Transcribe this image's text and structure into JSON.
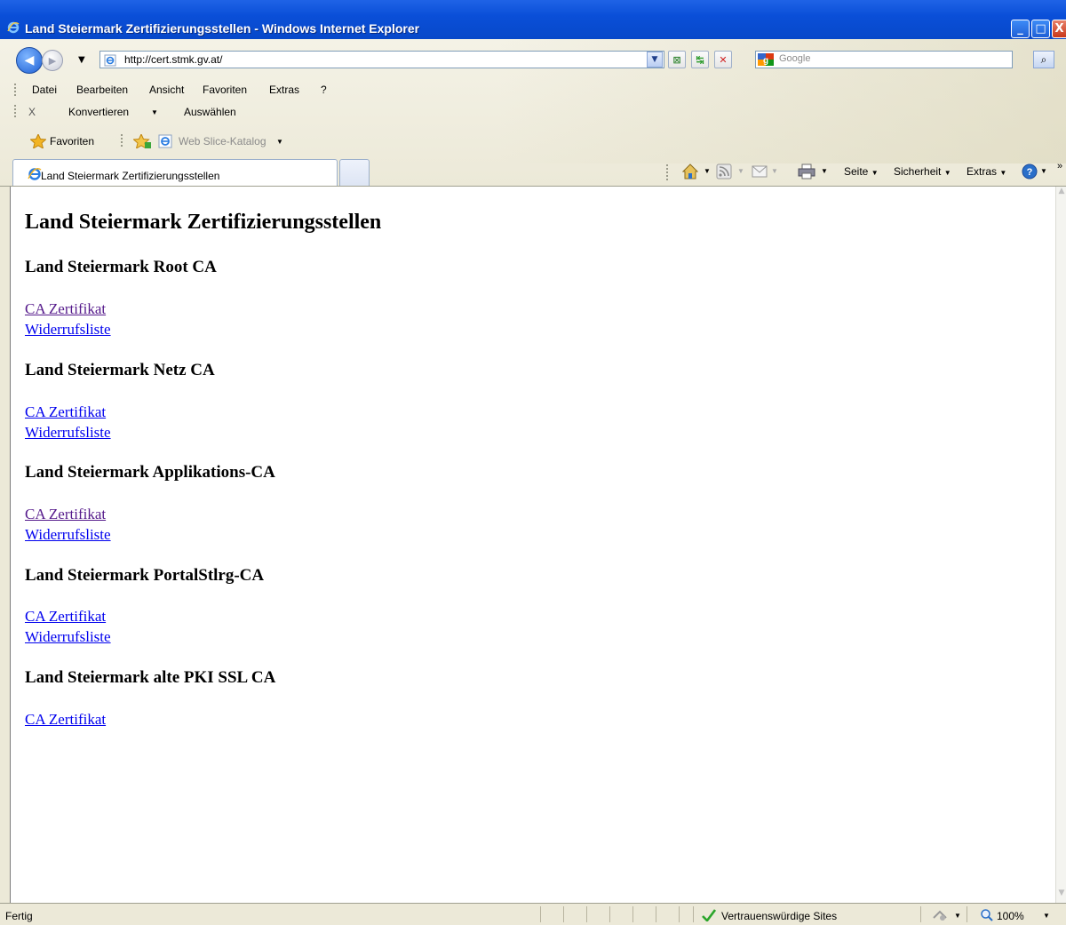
{
  "window": {
    "title": "Land Steiermark Zertifizierungsstellen - Windows Internet Explorer",
    "min_label": "_",
    "max_label": "□",
    "close_label": "X"
  },
  "address": {
    "url": "http://cert.stmk.gv.at/"
  },
  "search": {
    "placeholder": "Google"
  },
  "menu": {
    "items": [
      "Datei",
      "Bearbeiten",
      "Ansicht",
      "Favoriten",
      "Extras",
      "?"
    ]
  },
  "toolbar": {
    "close_glyph": "X",
    "convert_label": "Konvertieren",
    "select_label": "Auswählen"
  },
  "favorites": {
    "favorites_label": "Favoriten",
    "webslice_label": "Web Slice-Katalog"
  },
  "tabs": {
    "active_label": "Land Steiermark Zertifizierungsstellen"
  },
  "commandbar": {
    "page_label": "Seite",
    "safety_label": "Sicherheit",
    "tools_label": "Extras"
  },
  "page": {
    "title": "Land Steiermark Zertifizierungsstellen",
    "sections": [
      {
        "title": "Land Steiermark Root CA",
        "links": [
          "CA Zertifikat",
          "Widerrufsliste"
        ]
      },
      {
        "title": "Land Steiermark Netz CA",
        "links": [
          "CA Zertifikat",
          "Widerrufsliste"
        ]
      },
      {
        "title": "Land Steiermark Applikations-CA",
        "links": [
          "CA Zertifikat",
          "Widerrufsliste"
        ]
      },
      {
        "title": "Land Steiermark PortalStlrg-CA",
        "links": [
          "CA Zertifikat",
          "Widerrufsliste"
        ]
      },
      {
        "title": "Land Steiermark alte PKI SSL CA",
        "links": [
          "CA Zertifikat"
        ]
      }
    ]
  },
  "status": {
    "text": "Fertig",
    "zone": "Vertrauenswürdige Sites",
    "zoom": "100%"
  },
  "colors": {
    "titlebar": "#0a4fd8",
    "link": "#0000ee",
    "visited_link": "#551a8b",
    "chrome": "#ece9d8"
  }
}
